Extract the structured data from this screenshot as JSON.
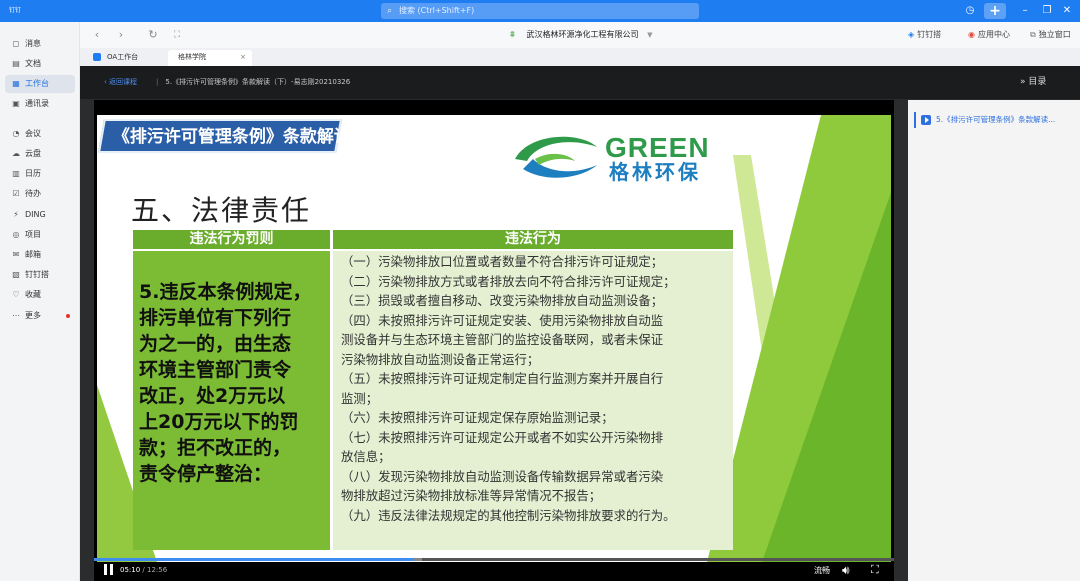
{
  "topbar": {
    "app_logo": "钉钉",
    "search_placeholder": "搜索 (Ctrl+Shift+F)",
    "history_icon": "history-icon",
    "plus_label": "+"
  },
  "sidebar": {
    "items": [
      {
        "label": "消息",
        "icon": "message-icon",
        "glyph": "◻"
      },
      {
        "label": "文档",
        "icon": "doc-icon",
        "glyph": "▤"
      },
      {
        "label": "工作台",
        "icon": "workbench-icon",
        "glyph": "▦",
        "active": true
      },
      {
        "label": "通讯录",
        "icon": "contacts-icon",
        "glyph": "▣"
      },
      {
        "label": "会议",
        "icon": "meeting-icon",
        "glyph": "◔"
      },
      {
        "label": "云盘",
        "icon": "cloud-icon",
        "glyph": "☁"
      },
      {
        "label": "日历",
        "icon": "calendar-icon",
        "glyph": "▥"
      },
      {
        "label": "待办",
        "icon": "todo-icon",
        "glyph": "☑"
      },
      {
        "label": "DING",
        "icon": "ding-icon",
        "glyph": "⚡"
      },
      {
        "label": "项目",
        "icon": "project-icon",
        "glyph": "◎"
      },
      {
        "label": "邮箱",
        "icon": "mail-icon",
        "glyph": "✉"
      },
      {
        "label": "钉钉搭",
        "icon": "builder-icon",
        "glyph": "▧"
      },
      {
        "label": "收藏",
        "icon": "favorite-icon",
        "glyph": "♡"
      },
      {
        "label": "更多",
        "icon": "more-icon",
        "glyph": "⋯",
        "badge": true
      }
    ]
  },
  "toolbar": {
    "company": "武汉格林环源净化工程有限公司",
    "dingdang_label": "钉钉搭",
    "app_center_label": "应用中心",
    "detach_label": "独立窗口"
  },
  "tabs": [
    {
      "label": "OA工作台"
    },
    {
      "label": "格林学院"
    }
  ],
  "course": {
    "back_label": "返回课程",
    "title": "5.《排污许可管理条例》条款解读（下）-易志刚20210326",
    "toc_label": "目录"
  },
  "slide": {
    "banner": "《排污许可管理条例》条款解读：下",
    "logo_word": "GREEN",
    "logo_cn": "格林环保",
    "heading": "五、法律责任",
    "table": {
      "col1_header": "违法行为罚则",
      "col2_header": "违法行为",
      "penalty_lines": [
        "5.违反本条例规定，",
        "排污单位有下列行",
        "为之一的，由生态",
        "环境主管部门责令",
        "改正，处2万元以",
        "上20万元以下的罚",
        "款；拒不改正的，",
        "责令停产整治："
      ],
      "behavior_lines": [
        "（一）污染物排放口位置或者数量不符合排污许可证规定；",
        "（二）污染物排放方式或者排放去向不符合排污许可证规定；",
        "（三）损毁或者擅自移动、改变污染物排放自动监测设备；",
        "（四）未按照排污许可证规定安装、使用污染物排放自动监",
        "测设备并与生态环境主管部门的监控设备联网，或者未保证",
        "污染物排放自动监测设备正常运行；",
        "（五）未按照排污许可证规定制定自行监测方案并开展自行",
        "监测；",
        "（六）未按照排污许可证规定保存原始监测记录；",
        "（七）未按照排污许可证规定公开或者不如实公开污染物排",
        "放信息；",
        "（八）发现污染物排放自动监测设备传输数据异常或者污染",
        "物排放超过污染物排放标准等异常情况不报告；",
        "（九）违反法律法规规定的其他控制污染物排放要求的行为。"
      ]
    }
  },
  "player": {
    "current_time": "05:10",
    "total_time": "/ 12:56",
    "progress_fraction": 0.4,
    "buffered_fraction": 0.41,
    "quality_label": "流畅"
  },
  "playlist": {
    "items": [
      {
        "label": "5.《排污许可管理条例》条款解读..."
      }
    ]
  },
  "colors": {
    "brand_blue": "#1f7df2",
    "slide_green": "#6aac2c",
    "progress_blue": "#3d8ef0"
  }
}
